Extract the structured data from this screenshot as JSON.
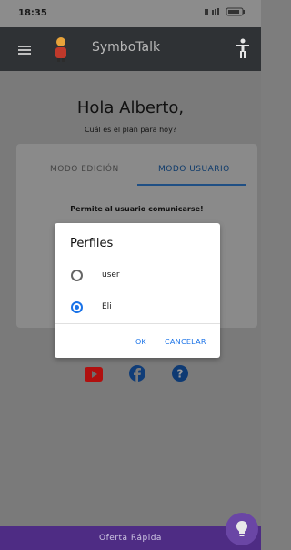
{
  "status": {
    "time": "18:35",
    "right": "✱ ‥̱ ▮▮ 82"
  },
  "app": {
    "title": "SymboTalk"
  },
  "main": {
    "greeting": "Hola Alberto,",
    "subtitle": "Cuál es el plan para hoy?",
    "tabs": [
      "MODO EDICIÓN",
      "MODO USUARIO"
    ],
    "description": "Permite al usuario comunicarse!"
  },
  "dialog": {
    "title": "Perfiles",
    "options": [
      {
        "label": "user",
        "selected": false
      },
      {
        "label": "Eli",
        "selected": true
      }
    ],
    "ok": "OK",
    "cancel": "CANCELAR"
  },
  "bottom": {
    "label": "Oferta Rápida"
  },
  "colors": {
    "accent": "#1a73e8",
    "appbar": "#2f3235",
    "bottombar": "#4e2c84",
    "fab": "#6a46a5"
  },
  "icons": {
    "menu": "hamburger-icon",
    "app": "symbotalk-logo-icon",
    "accessibility": "accessibility-icon",
    "youtube": "youtube-icon",
    "facebook": "facebook-icon",
    "help": "help-icon",
    "fab": "lightbulb-icon"
  }
}
